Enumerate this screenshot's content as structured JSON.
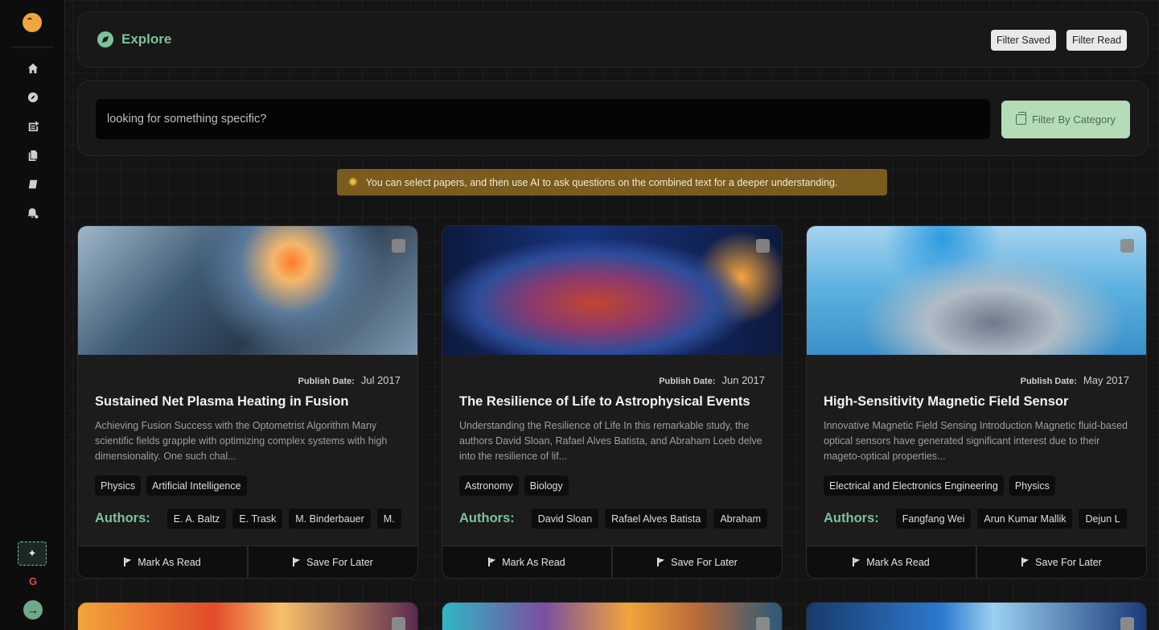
{
  "header": {
    "title": "Explore",
    "filter_saved": "Filter Saved",
    "filter_read": "Filter Read"
  },
  "search": {
    "placeholder": "looking for something specific?",
    "category_button": "Filter By Category"
  },
  "tip": "You can select papers, and then use AI to ask questions on the combined text for a deeper understanding.",
  "cards": [
    {
      "publish_label": "Publish Date:",
      "publish_date": "Jul 2017",
      "title": "Sustained Net Plasma Heating in Fusion",
      "description": "Achieving Fusion Success with the Optometrist Algorithm Many scientific fields grapple with optimizing complex systems with high dimensionality. One such chal...",
      "tags": [
        "Physics",
        "Artificial Intelligence"
      ],
      "authors_label": "Authors:",
      "authors": [
        "E. A. Baltz",
        "E. Trask",
        "M. Binderbauer",
        "M."
      ],
      "mark_read": "Mark As Read",
      "save_later": "Save For Later"
    },
    {
      "publish_label": "Publish Date:",
      "publish_date": "Jun 2017",
      "title": "The Resilience of Life to Astrophysical Events",
      "description": "Understanding the Resilience of Life In this remarkable study, the authors David Sloan, Rafael Alves Batista, and Abraham Loeb delve into the resilience of lif...",
      "tags": [
        "Astronomy",
        "Biology"
      ],
      "authors_label": "Authors:",
      "authors": [
        "David Sloan",
        "Rafael Alves Batista",
        "Abraham"
      ],
      "mark_read": "Mark As Read",
      "save_later": "Save For Later"
    },
    {
      "publish_label": "Publish Date:",
      "publish_date": "May 2017",
      "title": "High-Sensitivity Magnetic Field Sensor",
      "description": "Innovative Magnetic Field Sensing Introduction Magnetic fluid-based optical sensors have generated significant interest due to their mageto-optical properties...",
      "tags": [
        "Electrical and Electronics Engineering",
        "Physics"
      ],
      "authors_label": "Authors:",
      "authors": [
        "Fangfang Wei",
        "Arun Kumar Mallik",
        "Dejun L"
      ],
      "mark_read": "Mark As Read",
      "save_later": "Save For Later"
    }
  ],
  "icons": {
    "nav": [
      "home-icon",
      "compass-icon",
      "add-note-icon",
      "documents-icon",
      "notebook-icon",
      "notification-settings-icon"
    ],
    "ai": "sparkle-icon",
    "google": "google-icon",
    "go": "arrow-right-icon"
  },
  "sidebar": {
    "ai_glyph": "✦",
    "google_glyph": "G",
    "go_glyph": "→"
  },
  "colors": {
    "accent": "#7cc29c",
    "tip_bg": "#7a5c1e",
    "category_btn": "#b5dcb8"
  }
}
